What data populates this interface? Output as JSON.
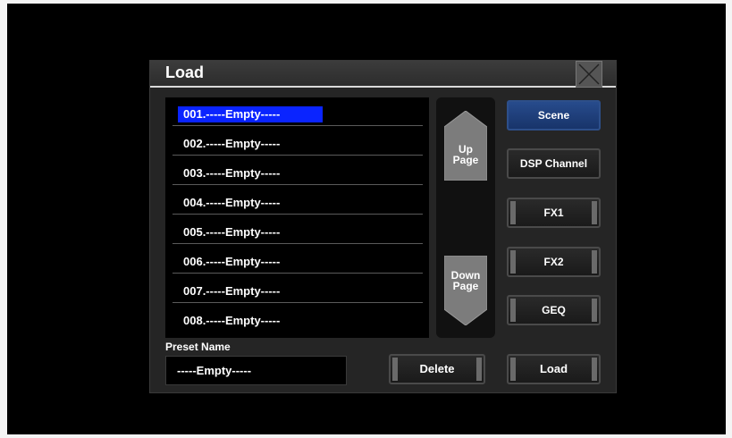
{
  "dialog": {
    "title": "Load",
    "close_icon": "close-x-icon"
  },
  "presets": {
    "selected_index": 0,
    "items": [
      "001.-----Empty-----",
      "002.-----Empty-----",
      "003.-----Empty-----",
      "004.-----Empty-----",
      "005.-----Empty-----",
      "006.-----Empty-----",
      "007.-----Empty-----",
      "008.-----Empty-----"
    ]
  },
  "paging": {
    "up_line1": "Up",
    "up_line2": "Page",
    "down_line1": "Down",
    "down_line2": "Page"
  },
  "categories": {
    "active": "Scene",
    "items": [
      "Scene",
      "DSP Channel",
      "FX1",
      "FX2",
      "GEQ"
    ]
  },
  "preset_name": {
    "label": "Preset Name",
    "value": "-----Empty-----"
  },
  "actions": {
    "delete_label": "Delete",
    "load_label": "Load"
  },
  "colors": {
    "selection": "#0a24ff",
    "active_button": "#274b8c",
    "background": "#000000",
    "panel": "#252525"
  }
}
